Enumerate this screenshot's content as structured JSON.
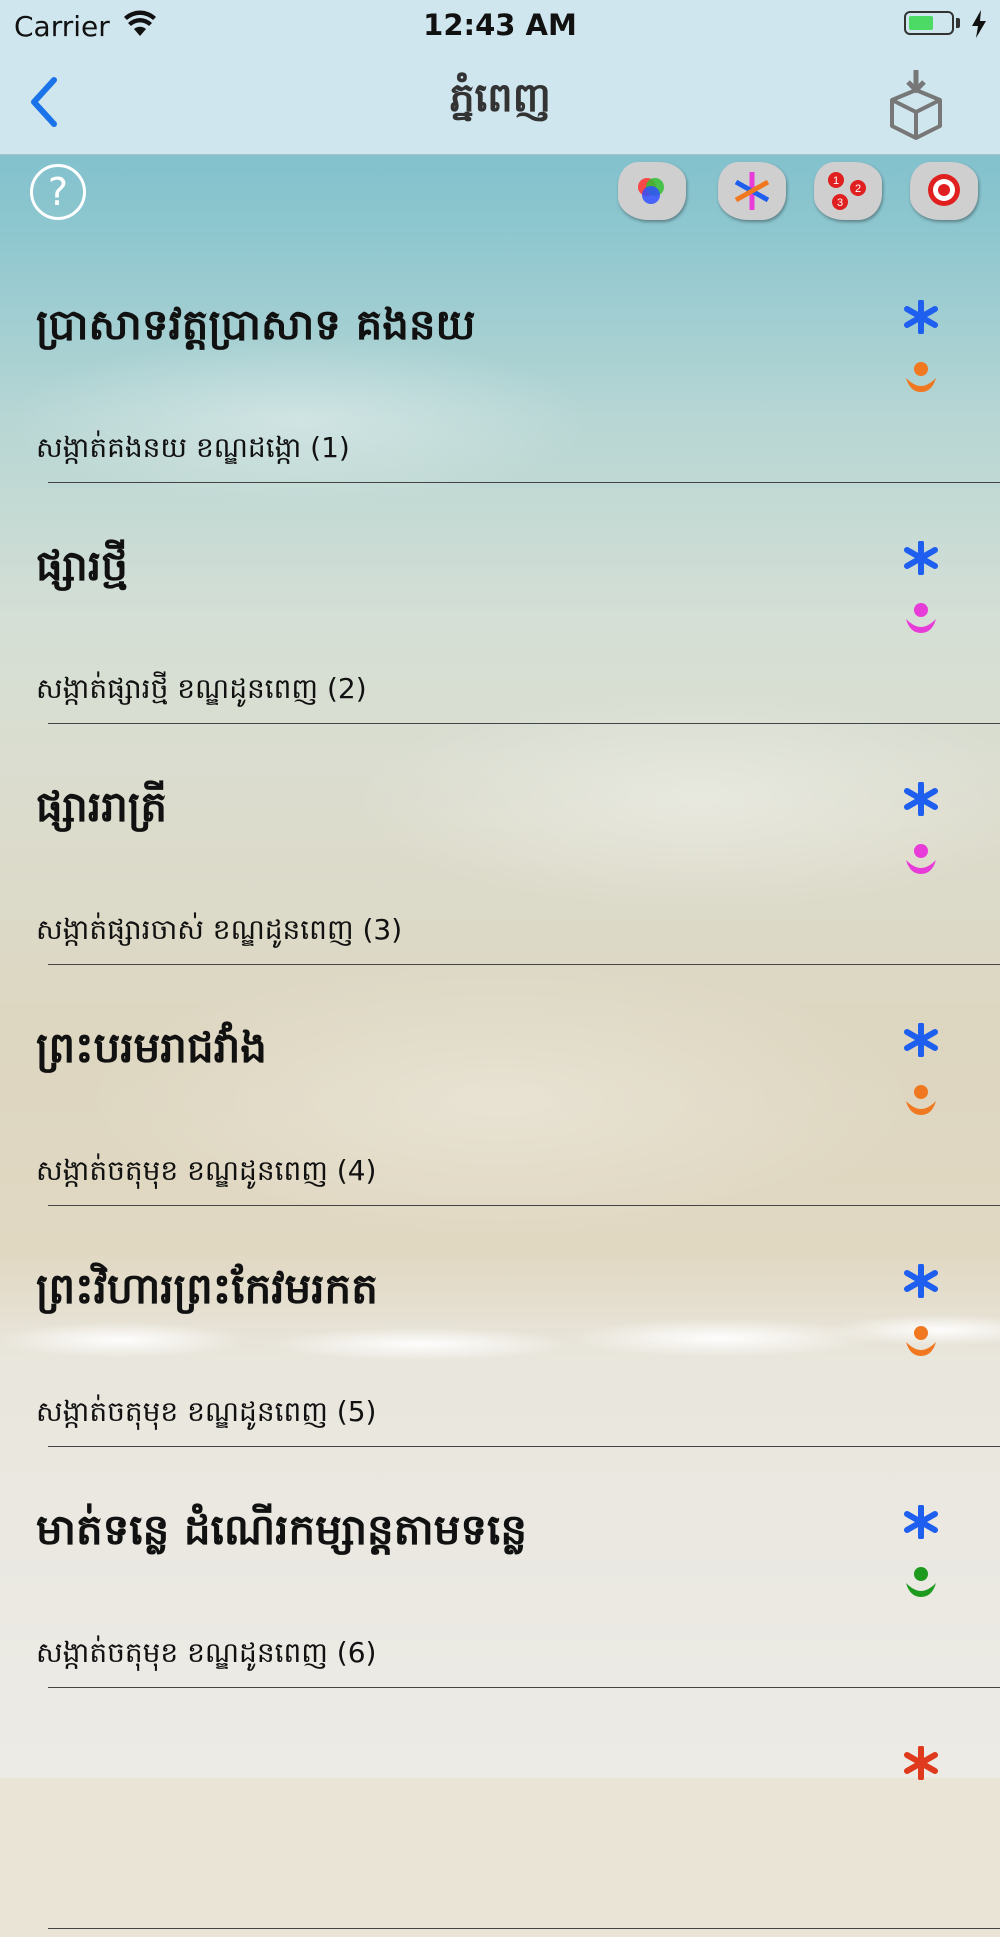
{
  "status_bar": {
    "carrier": "Carrier",
    "time": "12:43 AM",
    "battery_level": 0.6
  },
  "nav": {
    "back_icon": "chevron-left-icon",
    "title": "ភ្នំពេញ",
    "download_icon": "box-download-icon"
  },
  "toolbar": {
    "help_label": "?",
    "map_buttons": [
      {
        "name": "color-map-icon"
      },
      {
        "name": "category-map-icon"
      },
      {
        "name": "numbered-map-icon"
      },
      {
        "name": "target-map-icon"
      }
    ]
  },
  "colors": {
    "accent": "#1a73e8",
    "icon_blue": "#1e5ff0",
    "orange": "#f07820",
    "magenta": "#e83cd8",
    "green": "#1e9a1e",
    "red": "#e03a1e"
  },
  "items": [
    {
      "title": "ប្រាសាទវត្តប្រាសាទ គងនយ",
      "subtitle": "សង្កាត់គងនយ ខណ្ឌដង្កោ (1)",
      "icon_a": "asterisk-icon",
      "icon_a_color": "#1e5ff0",
      "icon_b": "person-icon",
      "icon_b_color": "#f07820"
    },
    {
      "title": "ផ្សារថ្មី",
      "subtitle": "សង្កាត់ផ្សារថ្មី  ខណ្ឌដូនពេញ (2)",
      "icon_a": "asterisk-icon",
      "icon_a_color": "#1e5ff0",
      "icon_b": "person-icon",
      "icon_b_color": "#e83cd8"
    },
    {
      "title": "ផ្សាររាត្រី",
      "subtitle": "សង្កាត់ផ្សារចាស់  ខណ្ឌដូនពេញ (3)",
      "icon_a": "asterisk-icon",
      "icon_a_color": "#1e5ff0",
      "icon_b": "person-icon",
      "icon_b_color": "#e83cd8"
    },
    {
      "title": "ព្រះបរមរាជវាំង",
      "subtitle": "សង្កាត់ចតុមុខ  ខណ្ឌដូនពេញ (4)",
      "icon_a": "asterisk-icon",
      "icon_a_color": "#1e5ff0",
      "icon_b": "person-icon",
      "icon_b_color": "#f07820"
    },
    {
      "title": "ព្រះវិហារព្រះកែវមរកត",
      "subtitle": "សង្កាត់ចតុមុខ  ខណ្ឌដូនពេញ (5)",
      "icon_a": "asterisk-icon",
      "icon_a_color": "#1e5ff0",
      "icon_b": "person-icon",
      "icon_b_color": "#f07820"
    },
    {
      "title": "មាត់ទន្លេ ដំណើរកម្សាន្តតាមទន្លេ",
      "subtitle": "សង្កាត់ចតុមុខ  ខណ្ឌដូនពេញ (6)",
      "icon_a": "asterisk-icon",
      "icon_a_color": "#1e5ff0",
      "icon_b": "person-icon",
      "icon_b_color": "#1e9a1e"
    },
    {
      "title": "",
      "subtitle": "",
      "icon_a": "asterisk-icon",
      "icon_a_color": "#e03a1e",
      "icon_b": "",
      "icon_b_color": ""
    }
  ]
}
